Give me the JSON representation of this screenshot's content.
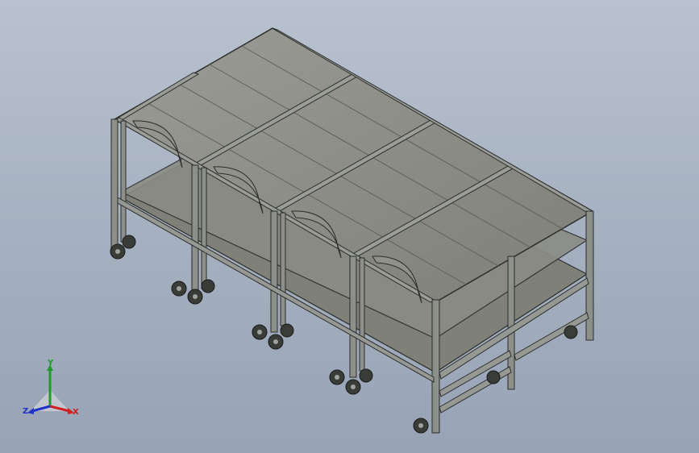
{
  "viewport": {
    "background_top": "#b9c2cf",
    "background_bottom": "#98a4b6"
  },
  "model": {
    "frame_color": "#8c8f8a",
    "frame_edge": "#2b2d2b",
    "shelf_color": "#8a8c84",
    "wheel_color": "#3a3c3a"
  },
  "triad": {
    "x_label": "X",
    "y_label": "Y",
    "z_label": "Z",
    "x_color": "#d02020",
    "y_color": "#1f9a2a",
    "z_color": "#2030c8"
  }
}
